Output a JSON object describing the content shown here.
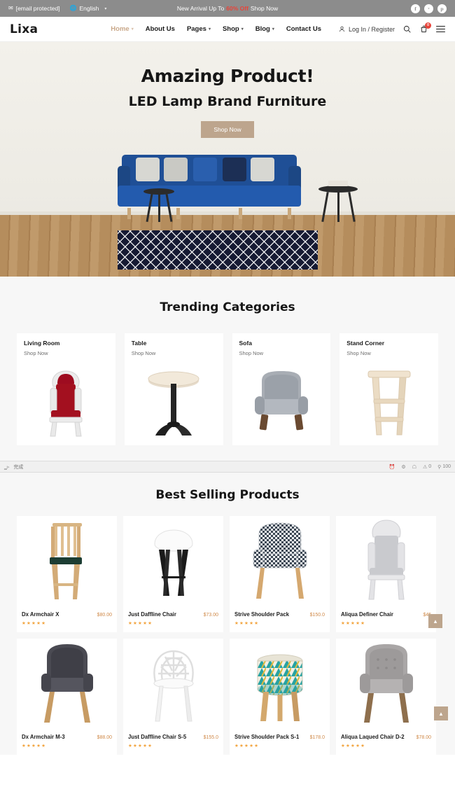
{
  "topbar": {
    "email": "[email protected]",
    "email_icon": "envelope-icon",
    "language": "English",
    "language_icon": "globe-icon",
    "caret": "▾",
    "promo_prefix": "New Arrival Up To",
    "promo_highlight": "60% Off",
    "promo_cta": "Shop Now",
    "socials": [
      {
        "name": "facebook-icon",
        "glyph": "f"
      },
      {
        "name": "twitter-icon",
        "glyph": "ᵛ"
      },
      {
        "name": "pinterest-icon",
        "glyph": "p"
      }
    ]
  },
  "header": {
    "logo": "Lixa",
    "nav": [
      {
        "label": "Home",
        "has_caret": true,
        "active": true
      },
      {
        "label": "About Us",
        "has_caret": false,
        "active": false
      },
      {
        "label": "Pages",
        "has_caret": true,
        "active": false
      },
      {
        "label": "Shop",
        "has_caret": true,
        "active": false
      },
      {
        "label": "Blog",
        "has_caret": true,
        "active": false
      },
      {
        "label": "Contact Us",
        "has_caret": false,
        "active": false
      }
    ],
    "login_label": "Log In / Register",
    "login_icon": "user-icon",
    "search_icon": "search-icon",
    "cart_icon": "cart-icon",
    "cart_badge": "0",
    "menu_icon": "hamburger-menu-icon"
  },
  "hero": {
    "title": "Amazing Product!",
    "subtitle": "LED Lamp Brand Furniture",
    "button": "Shop Now"
  },
  "trending": {
    "title": "Trending Categories",
    "categories": [
      {
        "name": "Living Room",
        "link": "Shop Now",
        "image": "red-velvet-throne-chair"
      },
      {
        "name": "Table",
        "link": "Shop Now",
        "image": "round-bistro-table"
      },
      {
        "name": "Sofa",
        "link": "Shop Now",
        "image": "grey-tufted-armchair"
      },
      {
        "name": "Stand Corner",
        "link": "Shop Now",
        "image": "wooden-bar-stool"
      }
    ]
  },
  "statusbar": {
    "left_icon": "page-icon",
    "left_text": "完成",
    "items": [
      {
        "name": "history-icon",
        "value": ""
      },
      {
        "name": "settings-icon",
        "value": ""
      },
      {
        "name": "shield-icon",
        "value": ""
      },
      {
        "name": "notification-icon",
        "value": "0"
      },
      {
        "name": "zoom-icon",
        "value": "100"
      }
    ]
  },
  "best": {
    "title": "Best Selling Products",
    "products": [
      {
        "name": "Dx Armchair X",
        "price": "$80.00",
        "stars": "★★★★★",
        "image": "wooden-bar-stool-dark-seat"
      },
      {
        "name": "Just Daffline Chair",
        "price": "$73.00",
        "stars": "★★★★★",
        "image": "white-stool-black-legs"
      },
      {
        "name": "Strive Shoulder Pack",
        "price": "$150.0",
        "stars": "★★★★★",
        "image": "houndstooth-armchair"
      },
      {
        "name": "Aliqua Definer Chair",
        "price": "$45",
        "stars": "★★★★★",
        "image": "ornate-silver-throne"
      },
      {
        "name": "Dx Armchair M-3",
        "price": "$88.00",
        "stars": "★★★★★",
        "image": "dark-grey-swivel-chair"
      },
      {
        "name": "Just Daffline Chair S-5",
        "price": "$155.0",
        "stars": "★★★★★",
        "image": "white-lattice-chair"
      },
      {
        "name": "Strive Shoulder Pack S-1",
        "price": "$178.0",
        "stars": "★★★★★",
        "image": "patterned-drum-stool"
      },
      {
        "name": "Aliqua Laqued Chair D-2",
        "price": "$78.00",
        "stars": "★★★★★",
        "image": "grey-tufted-lounge-chair"
      }
    ]
  },
  "scroll_top": {
    "glyph": "▴",
    "name": "scroll-to-top-button"
  }
}
